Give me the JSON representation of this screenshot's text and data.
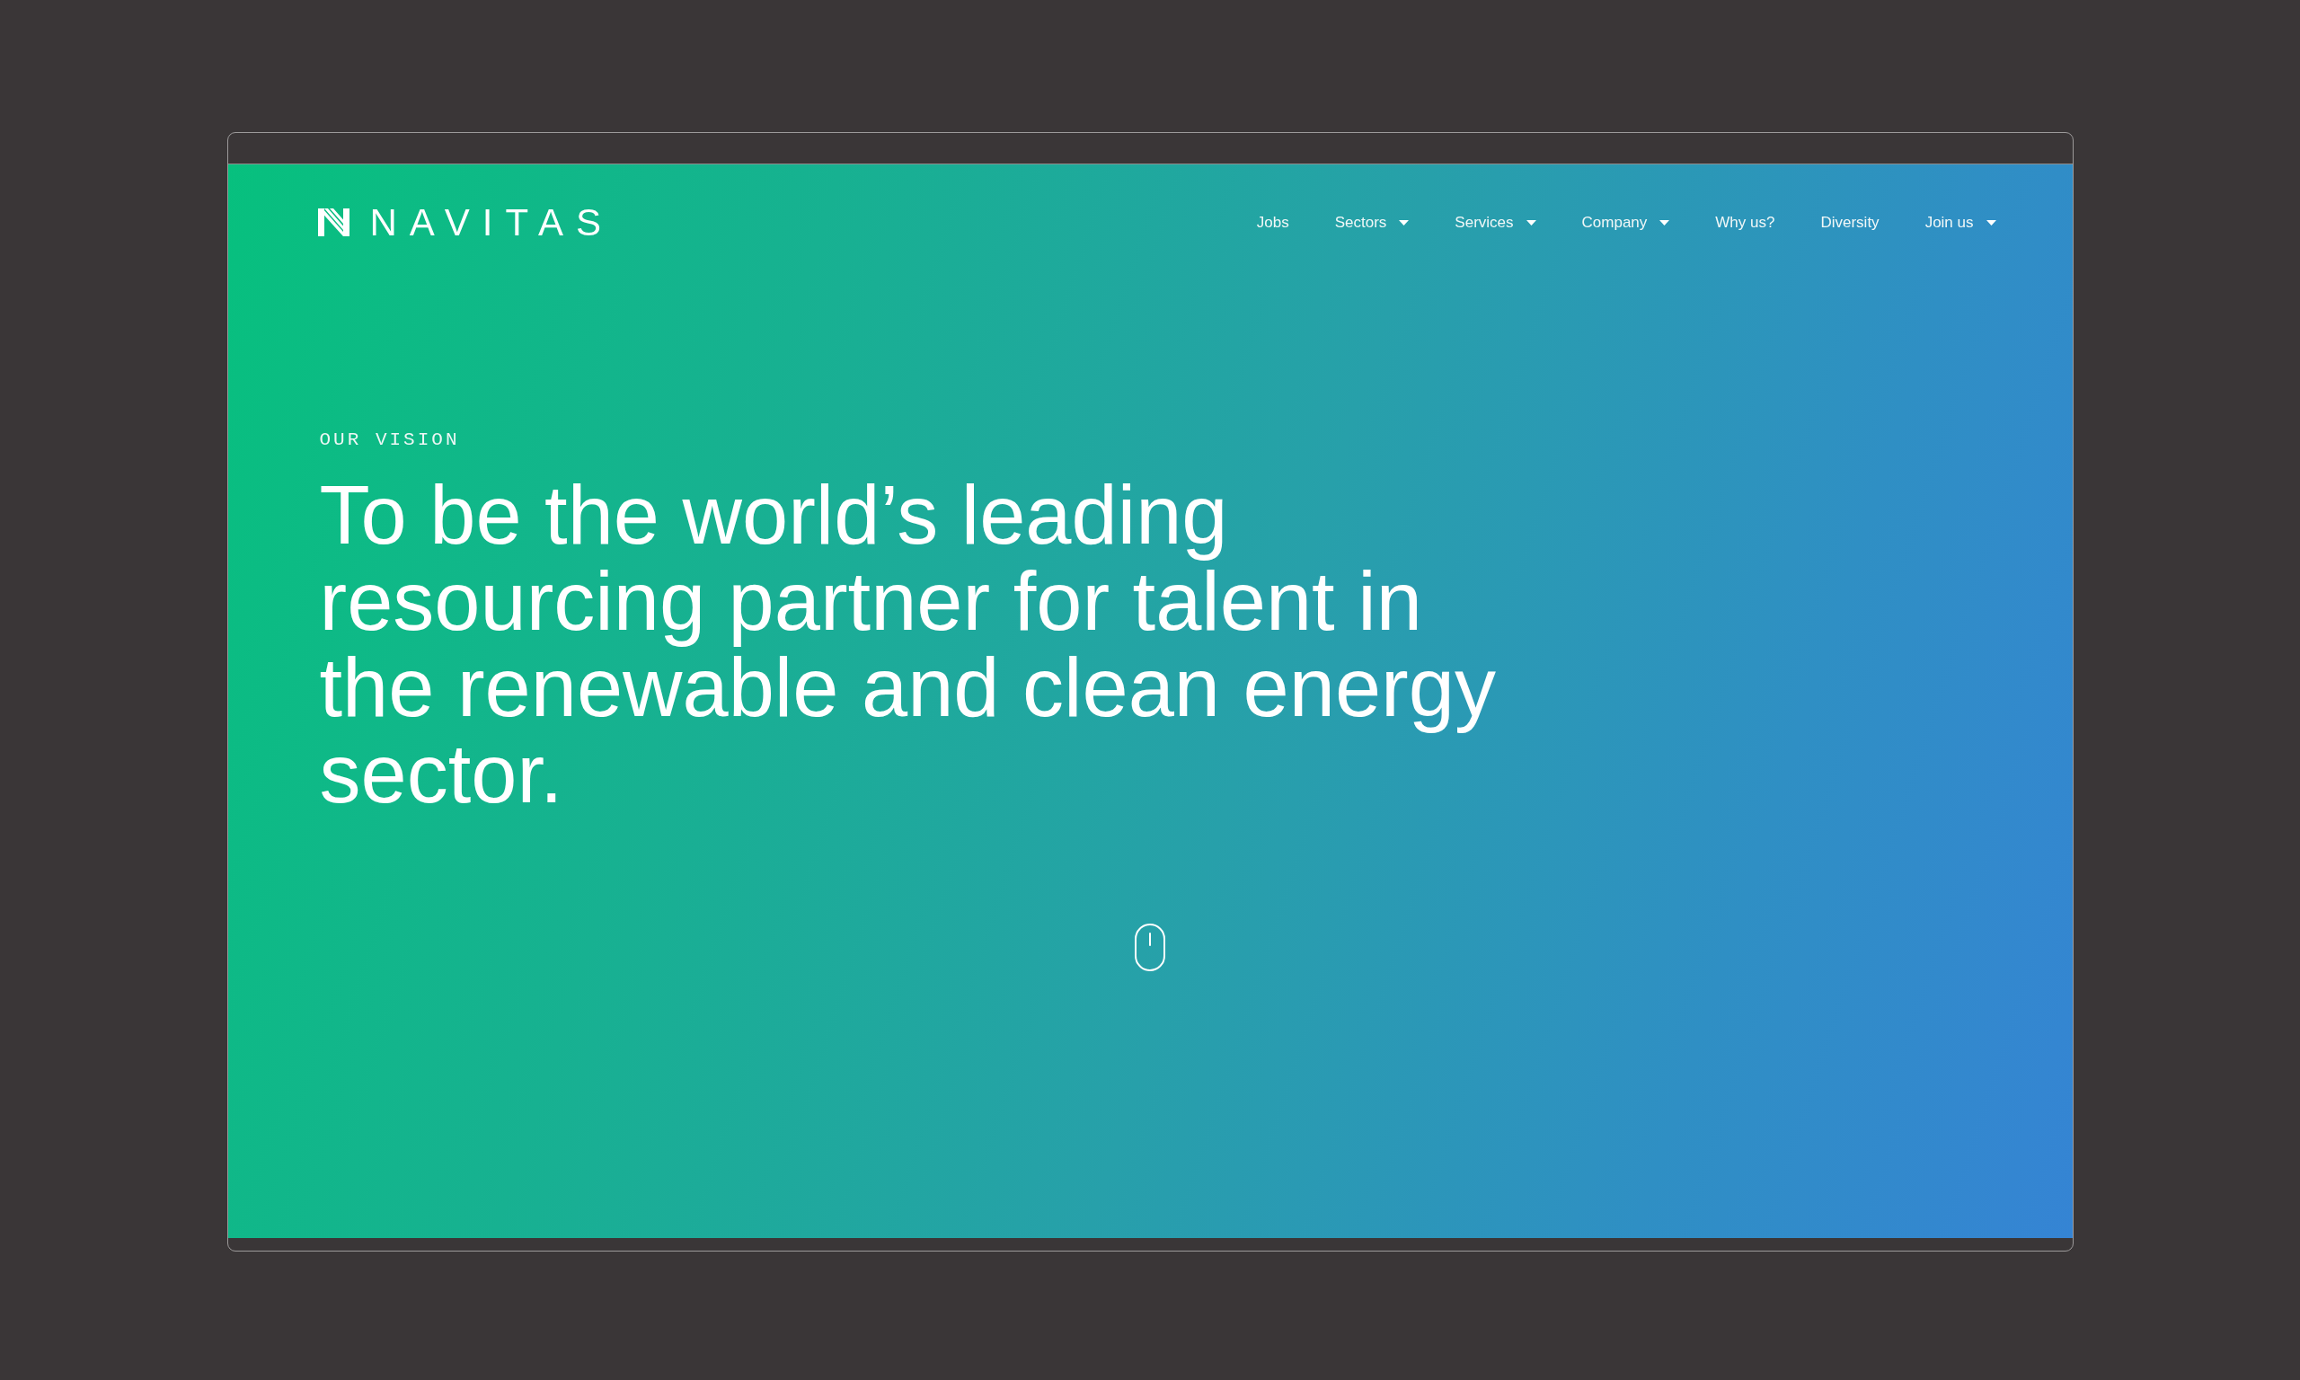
{
  "header": {
    "logo": {
      "wordmark": "NAVITAS"
    },
    "nav": [
      {
        "label": "Jobs",
        "kind": "link"
      },
      {
        "label": "Sectors",
        "kind": "dropdown"
      },
      {
        "label": "Services",
        "kind": "dropdown"
      },
      {
        "label": "Company",
        "kind": "dropdown"
      },
      {
        "label": "Why us?",
        "kind": "link"
      },
      {
        "label": "Diversity",
        "kind": "link"
      },
      {
        "label": "Join us",
        "kind": "dropdown"
      }
    ]
  },
  "hero": {
    "eyebrow": "OUR VISION",
    "heading": "To be the world’s leading resourcing partner for talent in the renewable and clean energy sector."
  }
}
